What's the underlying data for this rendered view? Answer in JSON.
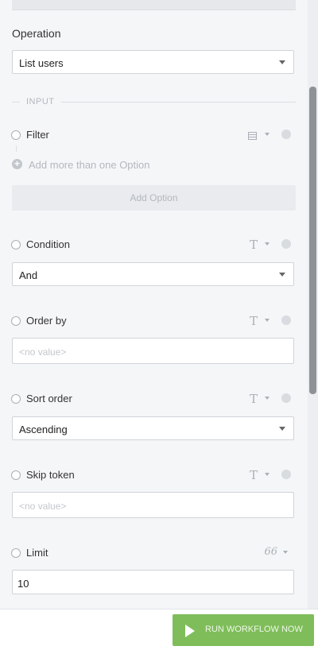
{
  "operation": {
    "label": "Operation",
    "selected": "List users"
  },
  "input_section": {
    "label": "INPUT"
  },
  "fields": {
    "filter": {
      "label": "Filter",
      "add_more": "Add more than one Option",
      "add_option": "Add Option",
      "type_icon": "list-icon"
    },
    "condition": {
      "label": "Condition",
      "value": "And",
      "type_icon": "text-type-icon",
      "type_glyph": "T"
    },
    "order_by": {
      "label": "Order by",
      "placeholder": "<no value>",
      "type_icon": "text-type-icon",
      "type_glyph": "T"
    },
    "sort_order": {
      "label": "Sort order",
      "value": "Ascending",
      "type_icon": "text-type-icon",
      "type_glyph": "T"
    },
    "skip_token": {
      "label": "Skip token",
      "placeholder": "<no value>",
      "type_icon": "text-type-icon",
      "type_glyph": "T"
    },
    "limit": {
      "label": "Limit",
      "value": "10",
      "type_icon": "number-type-icon",
      "type_glyph": "66"
    }
  },
  "footer": {
    "run_label": "RUN WORKFLOW NOW"
  },
  "colors": {
    "run_button": "#7fbd5a",
    "background": "#f5f6f8",
    "border": "#d0d4d9"
  }
}
